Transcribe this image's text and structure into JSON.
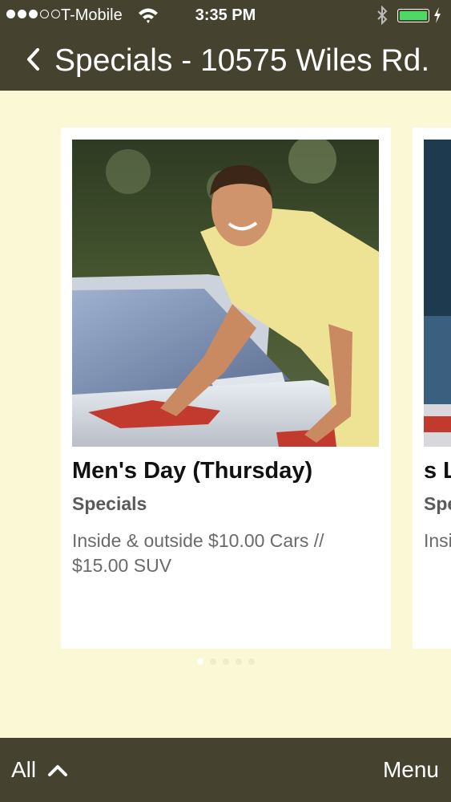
{
  "status_bar": {
    "carrier": "T-Mobile",
    "time": "3:35 PM",
    "signal_bars": 3,
    "signal_total": 5,
    "battery_level": 1.0
  },
  "nav": {
    "title": "Specials - 10575 Wiles Rd.",
    "back_icon": "chevron-left-icon"
  },
  "cards": [
    {
      "title": "Men's Day (Thursday)",
      "category": "Specials",
      "description": "Inside & outside $10.00 Cars // $15.00 SUV"
    },
    {
      "title": "s L",
      "category": "Spe",
      "description": "Insi SUV"
    }
  ],
  "pager": {
    "count": 5,
    "active": 0
  },
  "bottom": {
    "all_label": "All",
    "menu_label": "Menu"
  },
  "colors": {
    "bar": "#45432f",
    "background": "#fbf8d6",
    "battery": "#4cd964"
  }
}
